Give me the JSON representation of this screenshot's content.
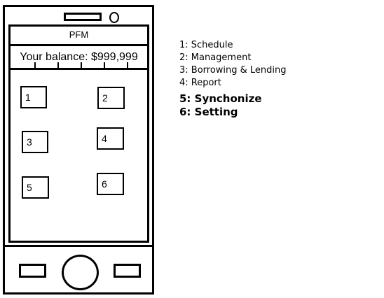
{
  "phone": {
    "app_title": "PFM",
    "balance": "Your balance: $999,999",
    "menu_boxes": [
      "1",
      "2",
      "3",
      "4",
      "5",
      "6"
    ]
  },
  "legend": {
    "items": [
      "1: Schedule",
      "2: Management",
      "3: Borrowing & Lending",
      "4: Report"
    ],
    "large_items": [
      "5:  Synchonize",
      "6:  Setting"
    ]
  }
}
